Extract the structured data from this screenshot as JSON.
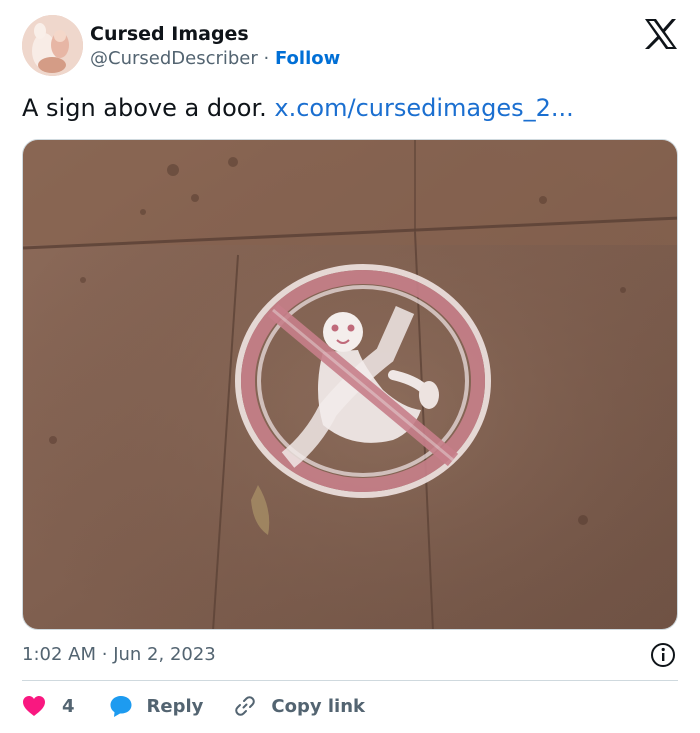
{
  "author": {
    "name": "Cursed Images",
    "handle": "@CursedDescriber",
    "separator": "·",
    "follow_label": "Follow"
  },
  "tweet": {
    "text": "A sign above a door.",
    "link_text": "x.com/cursedimages_2..."
  },
  "media": {
    "description_icon": "no-ghost-sign-photo"
  },
  "meta": {
    "time": "1:02 AM",
    "separator": "·",
    "date": "Jun 2, 2023"
  },
  "actions": {
    "like_count": "4",
    "reply_label": "Reply",
    "copy_label": "Copy link"
  },
  "colors": {
    "link": "#1b6fd0",
    "follow": "#006fd6",
    "like": "#f91880",
    "reply": "#1d9bf0",
    "text_secondary": "#536471"
  }
}
